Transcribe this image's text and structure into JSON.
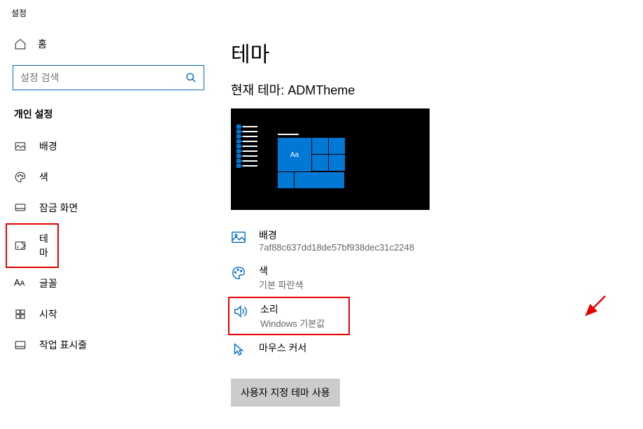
{
  "window": {
    "title": "설정"
  },
  "sidebar": {
    "home": "홈",
    "search_placeholder": "설정 검색",
    "section": "개인 설정",
    "items": [
      {
        "label": "배경",
        "icon": "image-icon"
      },
      {
        "label": "색",
        "icon": "palette-icon"
      },
      {
        "label": "잠금 화면",
        "icon": "lock-screen-icon"
      },
      {
        "label": "테마",
        "icon": "theme-icon",
        "selected": true
      },
      {
        "label": "글꼴",
        "icon": "font-icon"
      },
      {
        "label": "시작",
        "icon": "start-icon"
      },
      {
        "label": "작업 표시줄",
        "icon": "taskbar-icon"
      }
    ]
  },
  "main": {
    "title": "테마",
    "subtitle_prefix": "현재 테마: ",
    "current_theme": "ADMTheme",
    "preview_text": "Aa",
    "options": [
      {
        "title": "배경",
        "sub": "7af88c637dd18de57bf938dec31c2248"
      },
      {
        "title": "색",
        "sub": "기본 파란색"
      },
      {
        "title": "소리",
        "sub": "Windows 기본값",
        "highlighted": true
      },
      {
        "title": "마우스 커서",
        "sub": ""
      }
    ],
    "custom_button": "사용자 지정 테마 사용"
  }
}
